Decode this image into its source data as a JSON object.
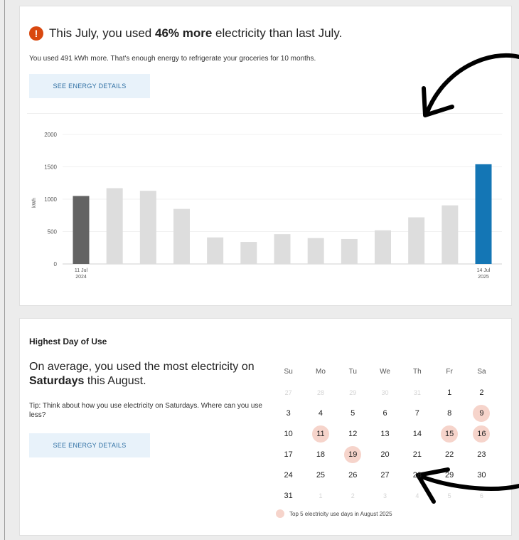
{
  "usage_card": {
    "alert_icon": "exclamation-icon",
    "headline_prefix": "This July, you used ",
    "headline_bold": "46% more",
    "headline_suffix": " electricity than last July.",
    "subtext": "You used 491 kWh more. That's enough energy to refrigerate your groceries for 10 months.",
    "details_button": "SEE ENERGY DETAILS"
  },
  "chart_data": {
    "type": "bar",
    "ylabel": "kWh",
    "ylim": [
      0,
      2000
    ],
    "yticks": [
      0,
      500,
      1000,
      1500,
      2000
    ],
    "values": [
      1050,
      1170,
      1130,
      850,
      410,
      340,
      460,
      400,
      385,
      520,
      720,
      905,
      1540
    ],
    "first_label": [
      "11 Jul",
      "2024"
    ],
    "last_label": [
      "14 Jul",
      "2025"
    ],
    "colors": {
      "first": "#636363",
      "middle": "#dddddd",
      "last": "#1476b5"
    },
    "grid": true
  },
  "highest_card": {
    "title": "Highest Day of Use",
    "main_prefix": "On average, you used the most electricity on ",
    "main_bold": "Saturdays",
    "main_suffix": " this August.",
    "tip": "Tip: Think about how you use electricity on Saturdays. Where can you use less?",
    "details_button": "SEE ENERGY DETAILS",
    "calendar": {
      "weekdays": [
        "Su",
        "Mo",
        "Tu",
        "We",
        "Th",
        "Fr",
        "Sa"
      ],
      "weeks": [
        [
          {
            "d": "27",
            "dim": true
          },
          {
            "d": "28",
            "dim": true
          },
          {
            "d": "29",
            "dim": true
          },
          {
            "d": "30",
            "dim": true
          },
          {
            "d": "31",
            "dim": true
          },
          {
            "d": "1"
          },
          {
            "d": "2"
          }
        ],
        [
          {
            "d": "3"
          },
          {
            "d": "4"
          },
          {
            "d": "5"
          },
          {
            "d": "6"
          },
          {
            "d": "7"
          },
          {
            "d": "8"
          },
          {
            "d": "9",
            "hl": true
          }
        ],
        [
          {
            "d": "10"
          },
          {
            "d": "11",
            "hl": true
          },
          {
            "d": "12"
          },
          {
            "d": "13"
          },
          {
            "d": "14"
          },
          {
            "d": "15",
            "hl": true
          },
          {
            "d": "16",
            "hl": true
          }
        ],
        [
          {
            "d": "17"
          },
          {
            "d": "18"
          },
          {
            "d": "19",
            "hl": true
          },
          {
            "d": "20"
          },
          {
            "d": "21"
          },
          {
            "d": "22"
          },
          {
            "d": "23"
          }
        ],
        [
          {
            "d": "24"
          },
          {
            "d": "25"
          },
          {
            "d": "26"
          },
          {
            "d": "27"
          },
          {
            "d": "28"
          },
          {
            "d": "29"
          },
          {
            "d": "30"
          }
        ],
        [
          {
            "d": "31"
          },
          {
            "d": "1",
            "dim": true
          },
          {
            "d": "2",
            "dim": true
          },
          {
            "d": "3",
            "dim": true
          },
          {
            "d": "4",
            "dim": true
          },
          {
            "d": "5",
            "dim": true
          },
          {
            "d": "6",
            "dim": true
          }
        ]
      ],
      "legend": "Top 5 electricity use days in August 2025",
      "highlight_color": "#f6d4cb"
    }
  },
  "annotations": {
    "arrow_icon": "hand-drawn-arrow-icon",
    "arrow_color": "#000000"
  }
}
